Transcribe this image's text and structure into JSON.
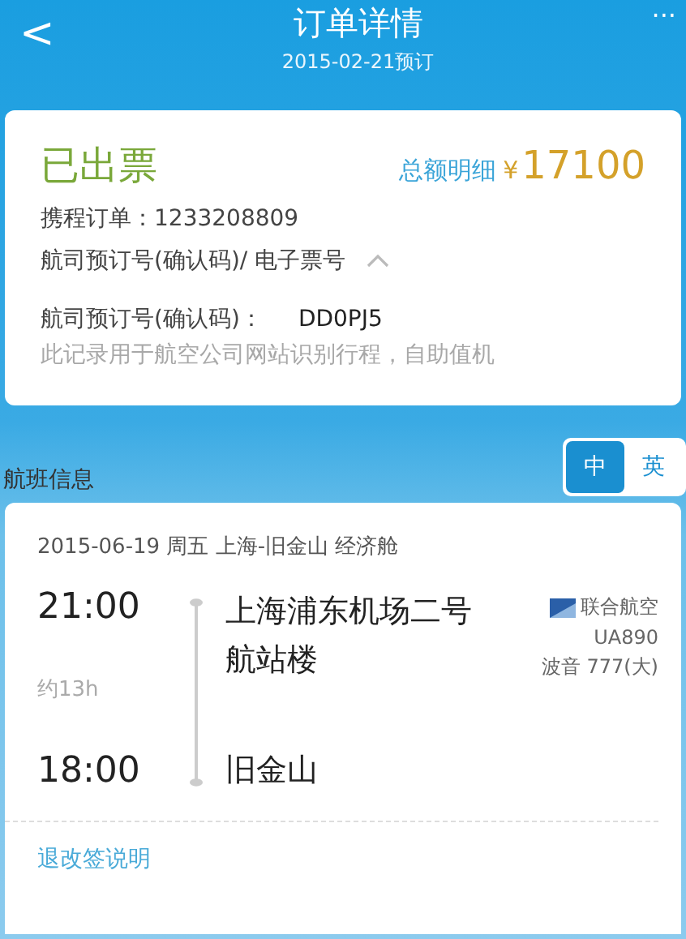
{
  "header": {
    "back": "<",
    "title": "订单详情",
    "subtitle": "2015-02-21预订",
    "more": "···"
  },
  "order": {
    "status": "已出票",
    "total_label": "总额明细",
    "currency": "¥",
    "total": "17100",
    "order_line": "携程订单：1233208809",
    "pnr_toggle": "航司预订号(确认码)/ 电子票号",
    "expanded": true,
    "pnr_label": "航司预订号(确认码)：",
    "pnr": "DD0PJ5",
    "note": "此记录用于航空公司网站识别行程，自助值机"
  },
  "flight_section": {
    "title": "航班信息",
    "languages": [
      {
        "label": "中",
        "selected": true
      },
      {
        "label": "英",
        "selected": false
      }
    ]
  },
  "flight": {
    "summary": "2015-06-19 周五  上海-旧金山  经济舱",
    "depart_time": "21:00",
    "depart_place": "上海浦东机场二号航站楼",
    "duration": "约13h",
    "arrive_time": "18:00",
    "arrive_place": "旧金山",
    "airline": "联合航空",
    "flight_no": "UA890",
    "aircraft": "波音 777(大)"
  },
  "footer_link": "退改签说明"
}
